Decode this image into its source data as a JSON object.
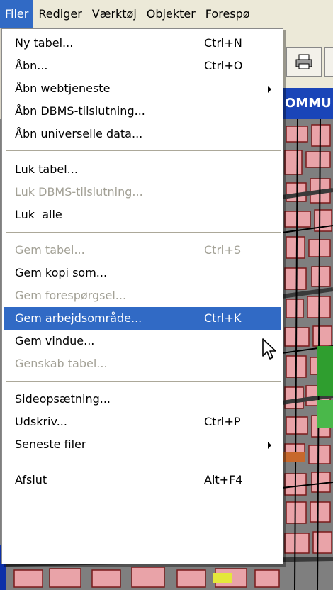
{
  "menubar": {
    "items": [
      {
        "label": "Filer",
        "active": true
      },
      {
        "label": "Rediger",
        "active": false
      },
      {
        "label": "Værktøj",
        "active": false
      },
      {
        "label": "Objekter",
        "active": false
      },
      {
        "label": "Forespø",
        "active": false
      }
    ]
  },
  "window": {
    "title_fragment": "OMMU"
  },
  "menu": {
    "items": [
      {
        "label": "Ny tabel...",
        "shortcut": "Ctrl+N",
        "disabled": false
      },
      {
        "label": "Åbn...",
        "shortcut": "Ctrl+O",
        "disabled": false
      },
      {
        "label": "Åbn webtjeneste",
        "shortcut": "",
        "disabled": false,
        "submenu": true
      },
      {
        "label": "Åbn DBMS-tilslutning...",
        "shortcut": "",
        "disabled": false
      },
      {
        "label": "Åbn universelle data...",
        "shortcut": "",
        "disabled": false
      },
      {
        "label": "Luk tabel...",
        "shortcut": "",
        "disabled": false
      },
      {
        "label": "Luk DBMS-tilslutning...",
        "shortcut": "",
        "disabled": true
      },
      {
        "label": "Luk  alle",
        "shortcut": "",
        "disabled": false
      },
      {
        "label": "Gem tabel...",
        "shortcut": "Ctrl+S",
        "disabled": true
      },
      {
        "label": "Gem kopi som...",
        "shortcut": "",
        "disabled": false
      },
      {
        "label": "Gem forespørgsel...",
        "shortcut": "",
        "disabled": true
      },
      {
        "label": "Gem arbejdsområde...",
        "shortcut": "Ctrl+K",
        "disabled": false,
        "highlighted": true
      },
      {
        "label": "Gem vindue...",
        "shortcut": "",
        "disabled": false
      },
      {
        "label": "Genskab tabel...",
        "shortcut": "",
        "disabled": true
      },
      {
        "label": "Sideopsætning...",
        "shortcut": "",
        "disabled": false
      },
      {
        "label": "Udskriv...",
        "shortcut": "Ctrl+P",
        "disabled": false
      },
      {
        "label": "Seneste filer",
        "shortcut": "",
        "disabled": false,
        "submenu": true
      },
      {
        "label": "Afslut",
        "shortcut": "Alt+F4",
        "disabled": false
      }
    ]
  },
  "colors": {
    "highlight": "#316ac5",
    "disabled_text": "#a3a196",
    "menubar_bg": "#ece9d8"
  },
  "icons": {
    "toolbar_button": "print-icon",
    "cursor": "arrow-cursor-icon",
    "submenu": "submenu-arrow-icon"
  }
}
